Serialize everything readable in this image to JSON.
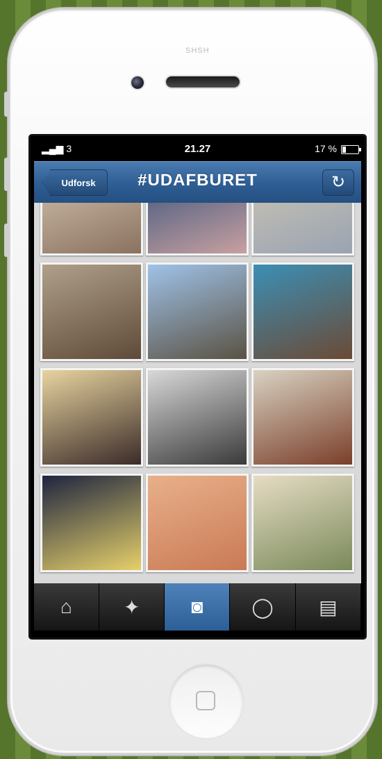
{
  "status": {
    "signal": "▂▄▆ 3",
    "time": "21.27",
    "battery": "17 %"
  },
  "nav": {
    "back_label": "Udforsk",
    "title": "#UDAFBURET",
    "refresh_icon": "↻"
  },
  "tiles": [
    {
      "name": "photo-cat",
      "colors": [
        "#d8c9b4",
        "#8a7260"
      ]
    },
    {
      "name": "photo-crowd",
      "colors": [
        "#2d4d7a",
        "#c8a0a0"
      ]
    },
    {
      "name": "photo-lampshade",
      "colors": [
        "#cfc8b4",
        "#9aa3b2"
      ]
    },
    {
      "name": "photo-dog-cage",
      "colors": [
        "#b0a08a",
        "#5e4a38"
      ]
    },
    {
      "name": "photo-building",
      "colors": [
        "#9fc2e8",
        "#5a5243"
      ]
    },
    {
      "name": "photo-blue-door",
      "colors": [
        "#3b8fb5",
        "#6b4a36"
      ]
    },
    {
      "name": "photo-bridge-sunset",
      "colors": [
        "#e8d4a0",
        "#3b2b28"
      ]
    },
    {
      "name": "photo-boys-bw",
      "colors": [
        "#d8d8d8",
        "#3a3a3a"
      ]
    },
    {
      "name": "photo-red-house",
      "colors": [
        "#d9d2c2",
        "#7a3f2a"
      ]
    },
    {
      "name": "photo-sign-dark",
      "colors": [
        "#1e2540",
        "#e6d06a"
      ]
    },
    {
      "name": "photo-box-orange",
      "colors": [
        "#e8b08a",
        "#c97a55"
      ]
    },
    {
      "name": "photo-child-tub",
      "colors": [
        "#e6dcc4",
        "#7a8a5a"
      ]
    }
  ],
  "tabs": [
    {
      "name": "home",
      "icon": "⌂"
    },
    {
      "name": "explore",
      "icon": "✦"
    },
    {
      "name": "camera",
      "icon": "◙"
    },
    {
      "name": "news",
      "icon": "◯"
    },
    {
      "name": "profile",
      "icon": "▤"
    }
  ],
  "phone": {
    "brand_text": "SHSH"
  }
}
